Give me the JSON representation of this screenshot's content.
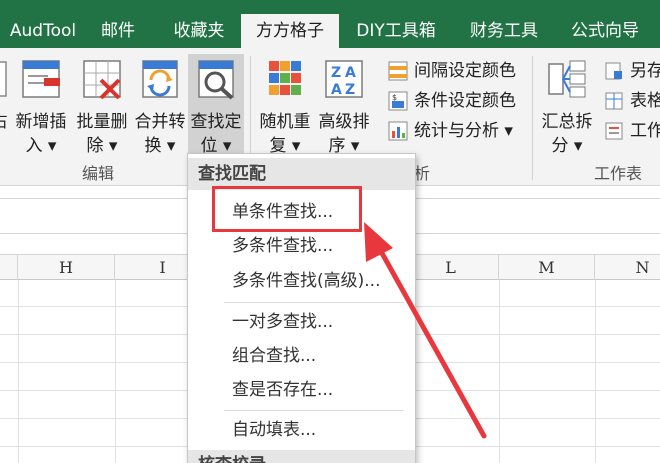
{
  "tabs": [
    {
      "label": "AudTool",
      "active": false
    },
    {
      "label": "邮件",
      "active": false
    },
    {
      "label": "收藏夹",
      "active": false
    },
    {
      "label": "方方格子",
      "active": true
    },
    {
      "label": "DIY工具箱",
      "active": false
    },
    {
      "label": "财务工具",
      "active": false
    },
    {
      "label": "公式向导",
      "active": false
    }
  ],
  "ribbon": {
    "partial_left": {
      "label_line1": "占"
    },
    "buttons": [
      {
        "line1": "新增插",
        "line2": "入 ▾"
      },
      {
        "line1": "批量删",
        "line2": "除 ▾"
      },
      {
        "line1": "合并转",
        "line2": "换 ▾"
      },
      {
        "line1": "查找定",
        "line2": "位 ▾"
      },
      {
        "line1": "随机重",
        "line2": "复 ▾"
      },
      {
        "line1": "高级排",
        "line2": "序 ▾"
      },
      {
        "line1": "汇总拆",
        "line2": "分 ▾"
      }
    ],
    "small_rows": [
      {
        "label": "间隔设定颜色"
      },
      {
        "label": "条件设定颜色"
      },
      {
        "label": "统计与分析 ▾"
      }
    ],
    "right_rows": [
      {
        "label": "另存"
      },
      {
        "label": "表格"
      },
      {
        "label": "工作"
      }
    ],
    "groups": {
      "edit": "编辑",
      "analysis_tail": "析",
      "worksheet": "工作表"
    }
  },
  "columns": [
    "H",
    "I",
    "L",
    "M",
    "N"
  ],
  "menu": {
    "header": "查找匹配",
    "items": [
      "单条件查找...",
      "多条件查找...",
      "多条件查找(高级)...",
      "一对多查找...",
      "组合查找...",
      "查是否存在...",
      "自动填表..."
    ],
    "footer_partial": "核查校录"
  },
  "colors": {
    "tab_green": "#217346",
    "highlight_red": "#e8383d"
  }
}
